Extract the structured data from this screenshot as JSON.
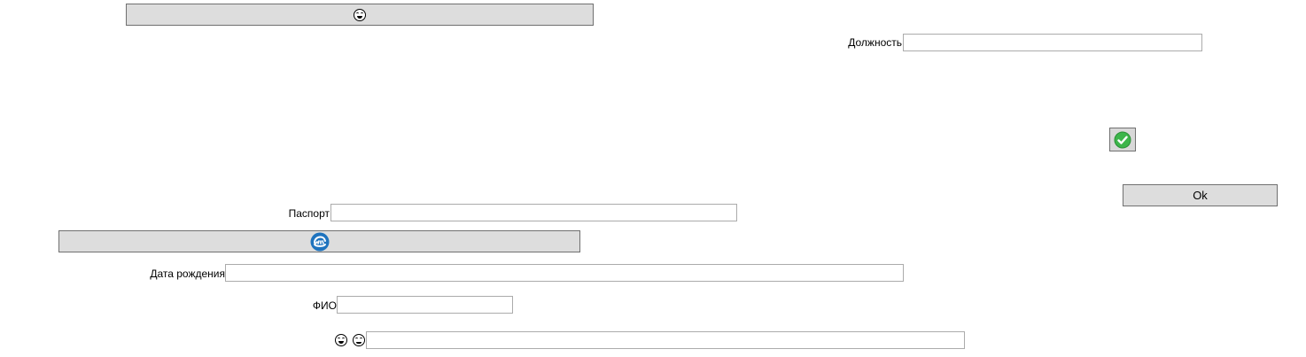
{
  "buttons": {
    "top_emoji_button": {
      "icon": "laughing-emoji-icon"
    },
    "blue_icon_button": {
      "icon": "blue-refresh-icon"
    },
    "check_button": {
      "icon": "green-check-icon"
    },
    "ok_label": "Ok"
  },
  "fields": {
    "position_label": "Должность",
    "position_value": "",
    "passport_label": "Паспорт",
    "passport_value": "",
    "birthdate_label": "Дата рождения",
    "birthdate_value": "",
    "fio_label": "ФИО",
    "fio_value": "",
    "emoji_field_value": ""
  },
  "bottom_emoji_icons": [
    "laughing-emoji-icon",
    "grinning-emoji-icon"
  ],
  "colors": {
    "button_bg": "#dddddd",
    "check_green": "#3cb54a",
    "blue_icon": "#1e73be"
  }
}
